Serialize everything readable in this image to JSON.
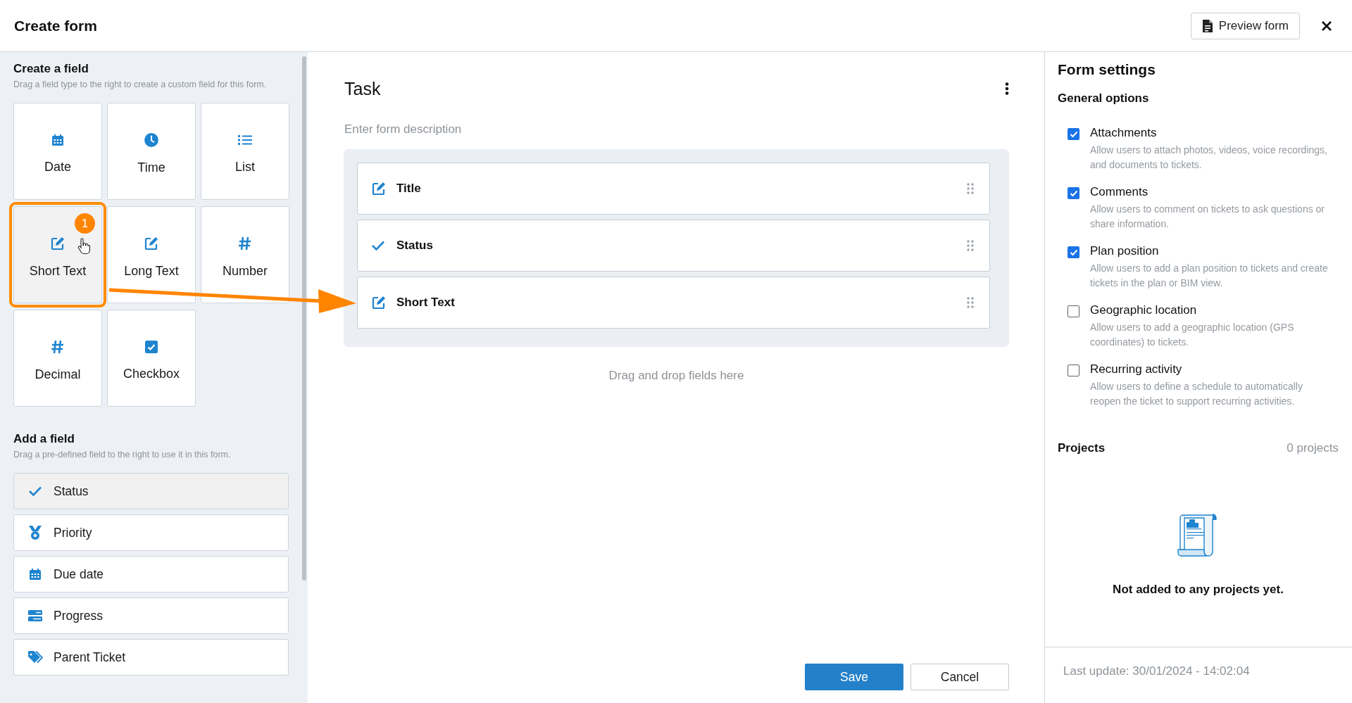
{
  "header": {
    "title": "Create form",
    "preview_button": "Preview form"
  },
  "create_field": {
    "title": "Create a field",
    "hint": "Drag a field type to the right to create a custom field for this form.",
    "tiles": [
      {
        "label": "Date",
        "kind": "calendar",
        "highlighted": false
      },
      {
        "label": "Time",
        "kind": "clock",
        "highlighted": false
      },
      {
        "label": "List",
        "kind": "list",
        "highlighted": false
      },
      {
        "label": "Short Text",
        "kind": "edit",
        "highlighted": true,
        "badge": "1"
      },
      {
        "label": "Long Text",
        "kind": "edit",
        "highlighted": false
      },
      {
        "label": "Number",
        "kind": "hash",
        "highlighted": false
      },
      {
        "label": "Decimal",
        "kind": "hash",
        "highlighted": false
      },
      {
        "label": "Checkbox",
        "kind": "checkbox",
        "highlighted": false
      }
    ]
  },
  "add_field": {
    "title": "Add a field",
    "hint": "Drag a pre-defined field to the right to use it in this form.",
    "items": [
      {
        "label": "Status",
        "kind": "check",
        "selected": true
      },
      {
        "label": "Priority",
        "kind": "medal",
        "selected": false
      },
      {
        "label": "Due date",
        "kind": "calendar",
        "selected": false
      },
      {
        "label": "Progress",
        "kind": "progress",
        "selected": false
      },
      {
        "label": "Parent Ticket",
        "kind": "tag",
        "selected": false
      }
    ]
  },
  "form": {
    "title": "Task",
    "description_placeholder": "Enter form description",
    "fields": [
      {
        "label": "Title",
        "kind": "edit"
      },
      {
        "label": "Status",
        "kind": "check"
      },
      {
        "label": "Short Text",
        "kind": "edit"
      }
    ],
    "drop_hint": "Drag and drop fields here",
    "buttons": [
      {
        "label": "Save",
        "kind": "primary"
      },
      {
        "label": "Cancel",
        "kind": "secondary"
      }
    ]
  },
  "settings": {
    "title": "Form settings",
    "section": "General options",
    "options": [
      {
        "label": "Attachments",
        "description": "Allow users to attach photos, videos, voice recordings, and documents to tickets.",
        "checked": true
      },
      {
        "label": "Comments",
        "description": "Allow users to comment on tickets to ask questions or share information.",
        "checked": true
      },
      {
        "label": "Plan position",
        "description": "Allow users to add a plan position to tickets and create tickets in the plan or BIM view.",
        "checked": true
      },
      {
        "label": "Geographic location",
        "description": "Allow users to add a geographic location (GPS coordinates) to tickets.",
        "checked": false
      },
      {
        "label": "Recurring activity",
        "description": "Allow users to define a schedule to automatically reopen the ticket to support recurring activities.",
        "checked": false
      }
    ],
    "projects": {
      "title": "Projects",
      "count": "0 projects",
      "empty_message": "Not added to any projects yet."
    },
    "last_update": "Last update: 30/01/2024 - 14:02:04"
  }
}
